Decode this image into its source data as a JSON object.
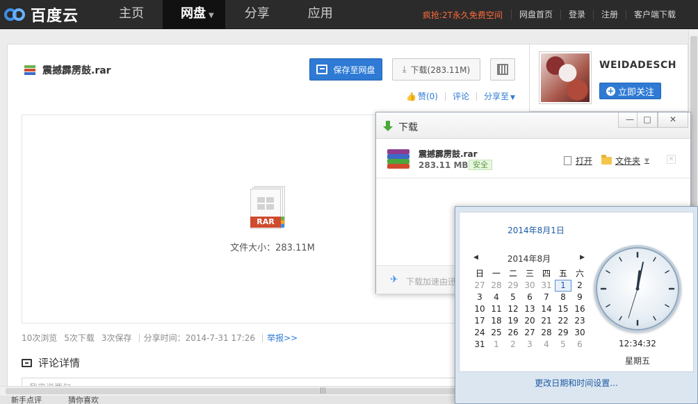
{
  "nav": {
    "logo_text": "百度云",
    "items": [
      {
        "label": "主页"
      },
      {
        "label": "网盘"
      },
      {
        "label": "分享"
      },
      {
        "label": "应用"
      }
    ],
    "promo": "疯抢:2T永久免费空间",
    "links": [
      "网盘首页",
      "登录",
      "注册",
      "客户端下载"
    ]
  },
  "file": {
    "name": "震撼霹雳鼓.rar",
    "save_label": "保存至网盘",
    "download_label": "下载(283.11M)",
    "like_label": "赞(0)",
    "comment_label": "评论",
    "share_label": "分享至",
    "badge": "RAR",
    "size_text": "文件大小：283.11M"
  },
  "stats": {
    "views": "10次浏览",
    "downloads": "5次下载",
    "saves": "3次保存",
    "share_time": "分享时间：2014-7-31 17:26",
    "report": "举报>>"
  },
  "comments": {
    "title": "评论详情",
    "placeholder": "我来说两句"
  },
  "profile": {
    "username": "WEIDADESCH",
    "follow_label": "立即关注"
  },
  "download_window": {
    "title": "下载",
    "file_name": "震撼霹雳鼓.rar",
    "file_size": "283.11 MB",
    "safe_label": "安全",
    "open_label": "打开",
    "folder_label": "文件夹",
    "footer_text": "下载加速由迅"
  },
  "calendar": {
    "full_date": "2014年8月1日",
    "month_label": "2014年8月",
    "weekdays": [
      "日",
      "一",
      "二",
      "三",
      "四",
      "五",
      "六"
    ],
    "weeks": [
      [
        "27",
        "28",
        "29",
        "30",
        "31",
        "1",
        "2"
      ],
      [
        "3",
        "4",
        "5",
        "6",
        "7",
        "8",
        "9"
      ],
      [
        "10",
        "11",
        "12",
        "13",
        "14",
        "15",
        "16"
      ],
      [
        "17",
        "18",
        "19",
        "20",
        "21",
        "22",
        "23"
      ],
      [
        "24",
        "25",
        "26",
        "27",
        "28",
        "29",
        "30"
      ],
      [
        "31",
        "1",
        "2",
        "3",
        "4",
        "5",
        "6"
      ]
    ],
    "time": "12:34:32",
    "weekday": "星期五",
    "change_link": "更改日期和时间设置..."
  },
  "statusbar": {
    "left": "新手点评",
    "right": "猜你喜欢"
  },
  "colors": {
    "accent": "#2e7ad4",
    "promo": "#ff6a3c",
    "nav_bg": "#2b2b2b"
  }
}
